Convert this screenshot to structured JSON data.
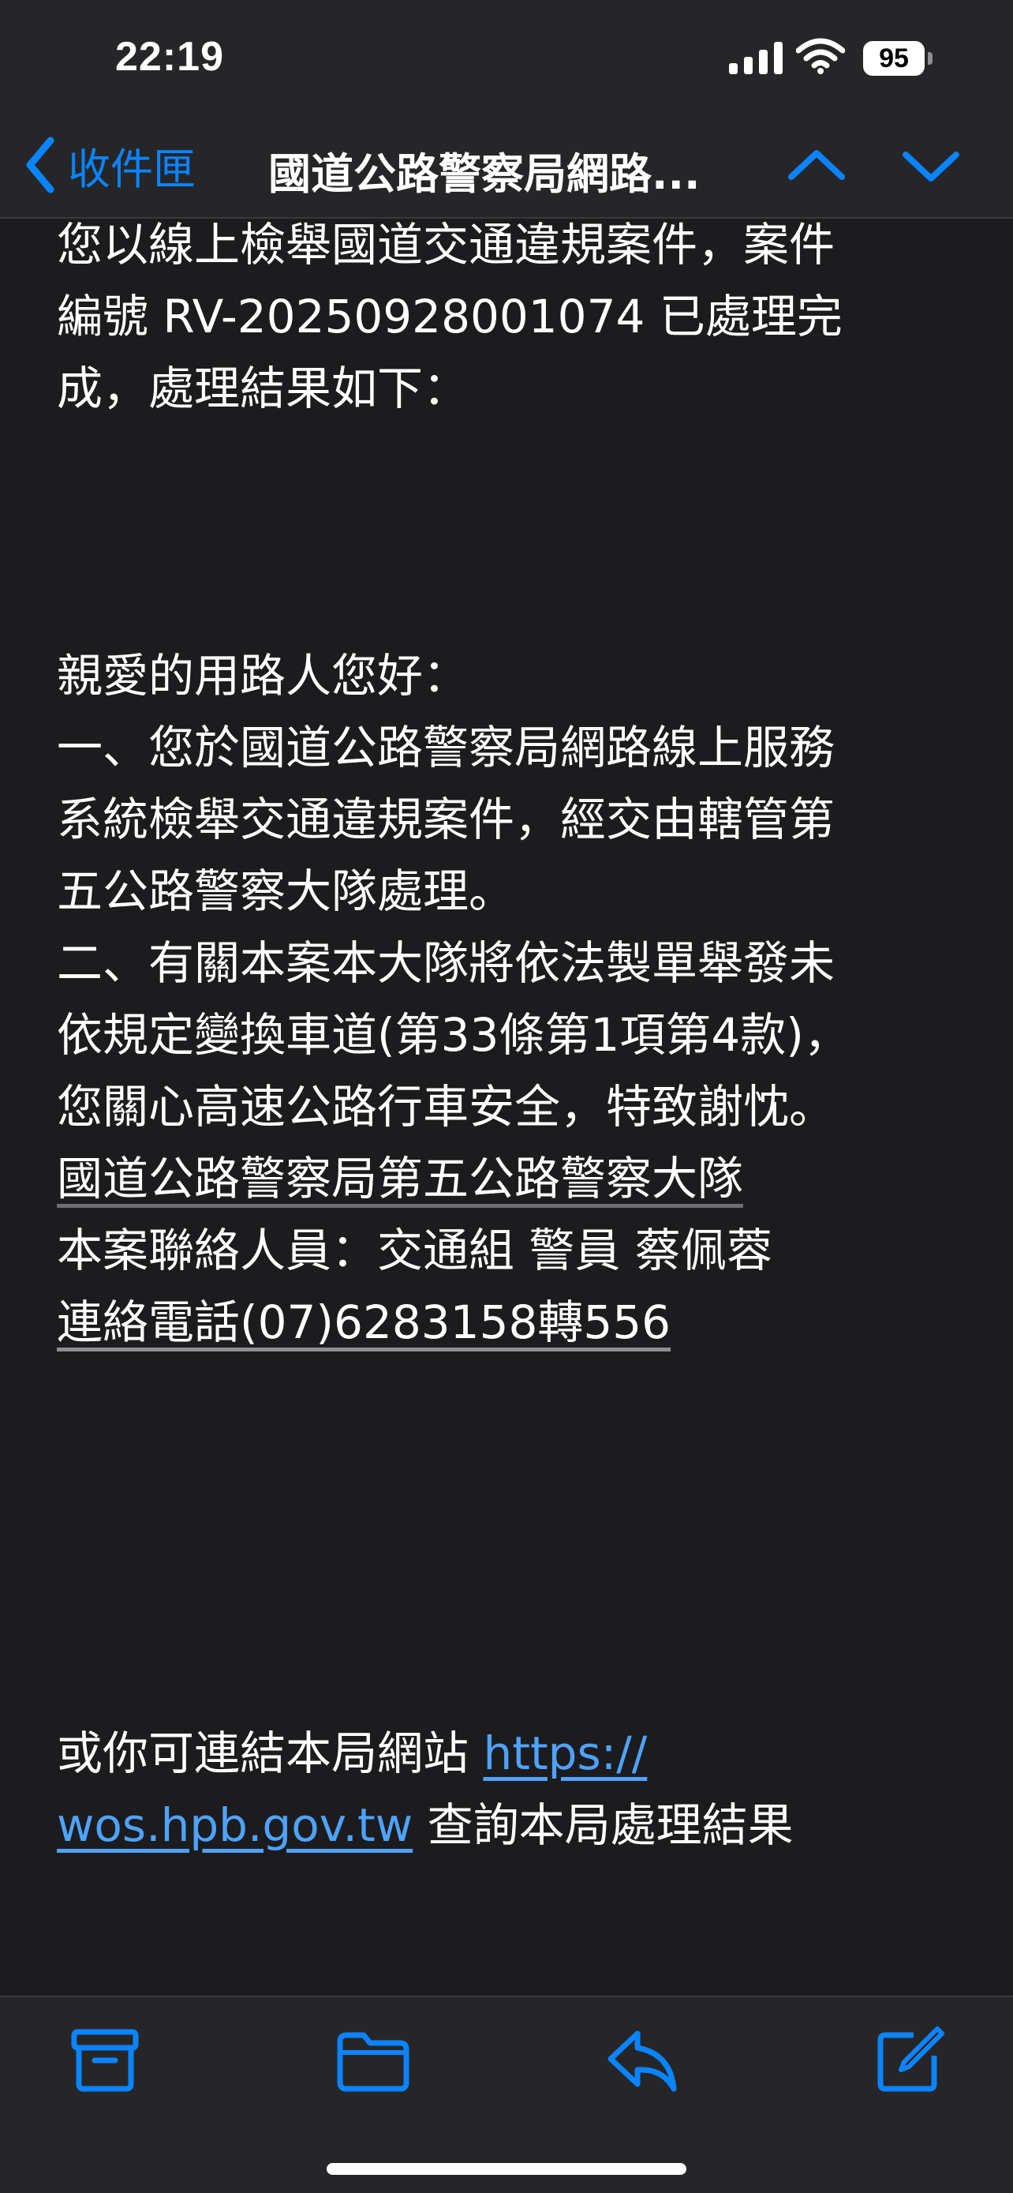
{
  "status_bar": {
    "time": "22:19",
    "battery": "95",
    "icons": [
      "signal-icon",
      "wifi-icon",
      "battery-icon"
    ]
  },
  "nav": {
    "back_label": "收件匣",
    "title": "國道公路警察局網路...",
    "icons": [
      "chevron-left-icon",
      "chevron-up-icon",
      "chevron-down-icon"
    ],
    "accent_color": "#0a84ff"
  },
  "message": {
    "intro": [
      "您以線上檢舉國道交通違規案件，案件",
      "編號 RV-20250928001074 已處理完",
      "成，處理結果如下："
    ],
    "body": [
      "親愛的用路人您好：",
      "一、您於國道公路警察局網路線上服務",
      "系統檢舉交通違規案件，經交由轄管第",
      "五公路警察大隊處理。",
      "二、有關本案本大隊將依法製單舉發未",
      "依規定變換車道(第33條第1項第4款)，",
      "您關心高速公路行車安全，特致謝忱。",
      "國道公路警察局第五公路警察大隊",
      "本案聯絡人員：交通組 警員 蔡佩蓉",
      "連絡電話(07)6283158轉556"
    ],
    "link_line1_prefix": "或你可連結本局網站 ",
    "link_part1": "https://",
    "link_part2": "wos.hpb.gov.tw",
    "link_line2_suffix": " 查詢本局處理結果",
    "link_color": "#4da3ff"
  },
  "toolbar": {
    "icons": [
      "archive-icon",
      "folder-icon",
      "reply-icon",
      "compose-icon"
    ]
  }
}
